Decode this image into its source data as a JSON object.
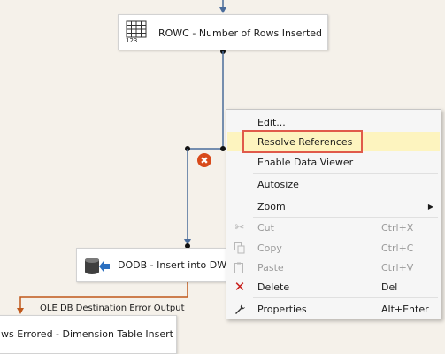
{
  "tasks": {
    "rowc": {
      "label": "ROWC - Number of Rows Inserted",
      "icon": "grid-123-icon",
      "icon_text": "123"
    },
    "dodb": {
      "label": "DODB - Insert into DW Di",
      "icon": "database-destination-icon"
    },
    "errored": {
      "label": "ws Errored - Dimension Table Insert"
    }
  },
  "error_output_label": "OLE DB Destination Error Output",
  "error_badge": {
    "icon": "error-x-icon",
    "glyph": "✖"
  },
  "context_menu": {
    "items": [
      {
        "label": "Edit...",
        "shortcut": "",
        "icon": "",
        "enabled": true
      },
      {
        "label": "Resolve References",
        "shortcut": "",
        "icon": "",
        "enabled": true,
        "highlighted": true
      },
      {
        "label": "Enable Data Viewer",
        "shortcut": "",
        "icon": "",
        "enabled": true
      },
      {
        "label": "Autosize",
        "shortcut": "",
        "icon": "",
        "enabled": true
      },
      {
        "label": "Zoom",
        "shortcut": "",
        "icon": "",
        "enabled": true,
        "submenu": true
      },
      {
        "label": "Cut",
        "shortcut": "Ctrl+X",
        "icon": "scissors-icon",
        "enabled": false
      },
      {
        "label": "Copy",
        "shortcut": "Ctrl+C",
        "icon": "copy-icon",
        "enabled": false
      },
      {
        "label": "Paste",
        "shortcut": "Ctrl+V",
        "icon": "paste-icon",
        "enabled": false
      },
      {
        "label": "Delete",
        "shortcut": "Del",
        "icon": "delete-x-icon",
        "enabled": true
      },
      {
        "label": "Properties",
        "shortcut": "Alt+Enter",
        "icon": "wrench-icon",
        "enabled": true
      }
    ]
  },
  "colors": {
    "canvas": "#f5f1ea",
    "data_path": "#4a6c9b",
    "error_path": "#c0581b",
    "highlight": "#fdf4bf",
    "callout": "#e05a4a",
    "delete_icon": "#c8201c"
  }
}
